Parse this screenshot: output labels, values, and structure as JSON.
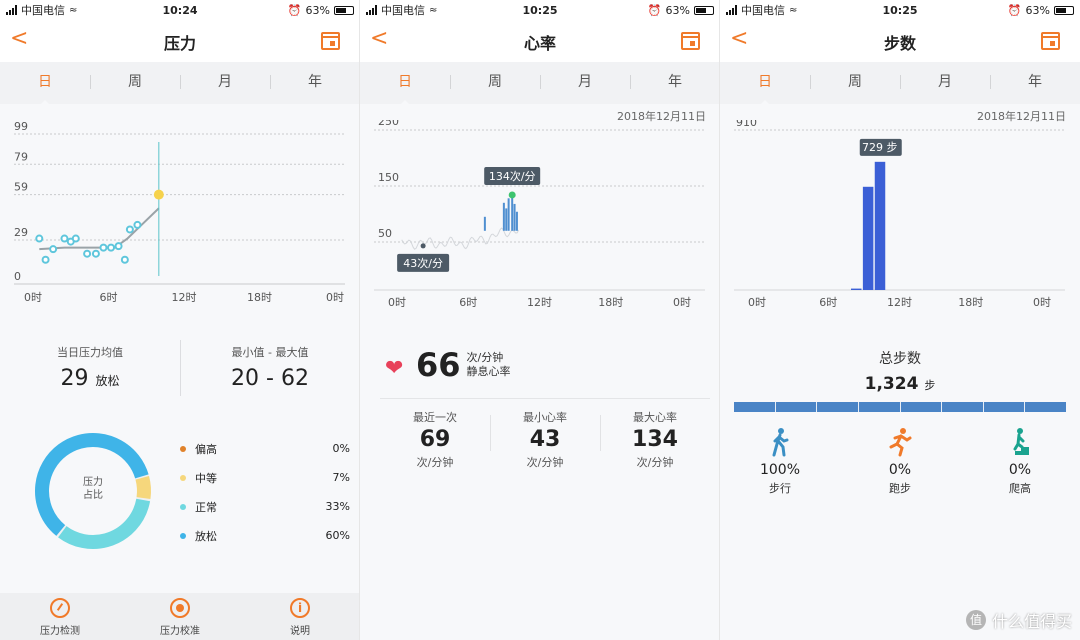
{
  "status_bars": [
    {
      "carrier": "中国电信",
      "time": "10:24",
      "battery": "63%",
      "battery_level": 0.63
    },
    {
      "carrier": "中国电信",
      "time": "10:25",
      "battery": "63%",
      "battery_level": 0.63
    },
    {
      "carrier": "中国电信",
      "time": "10:25",
      "battery": "63%",
      "battery_level": 0.63
    }
  ],
  "tabs": [
    "日",
    "周",
    "月",
    "年"
  ],
  "stress": {
    "title": "压力",
    "chart_data": {
      "type": "line",
      "title": "",
      "y_ticks": [
        "99",
        "79",
        "59",
        "29",
        "0"
      ],
      "x_ticks": [
        "0时",
        "6时",
        "12时",
        "18时",
        "0时"
      ],
      "ylim": [
        0,
        99
      ],
      "xlim_hours": [
        0,
        24
      ],
      "points": [
        {
          "hour": 0.5,
          "value": 30
        },
        {
          "hour": 1.0,
          "value": 16
        },
        {
          "hour": 1.6,
          "value": 23
        },
        {
          "hour": 2.5,
          "value": 30
        },
        {
          "hour": 3.0,
          "value": 28
        },
        {
          "hour": 3.4,
          "value": 30
        },
        {
          "hour": 4.3,
          "value": 20
        },
        {
          "hour": 5.0,
          "value": 20
        },
        {
          "hour": 5.6,
          "value": 24
        },
        {
          "hour": 6.2,
          "value": 24
        },
        {
          "hour": 6.8,
          "value": 25
        },
        {
          "hour": 7.3,
          "value": 16
        },
        {
          "hour": 7.7,
          "value": 36
        },
        {
          "hour": 8.3,
          "value": 39
        }
      ],
      "trend": [
        {
          "hour": 0.5,
          "value": 23
        },
        {
          "hour": 2.5,
          "value": 24
        },
        {
          "hour": 4.5,
          "value": 24
        },
        {
          "hour": 6.5,
          "value": 24
        },
        {
          "hour": 7.5,
          "value": 30
        },
        {
          "hour": 8.5,
          "value": 38
        },
        {
          "hour": 10.0,
          "value": 50
        }
      ],
      "current": {
        "hour": 10.0,
        "value": 59
      }
    },
    "avg_label": "当日压力均值",
    "avg_value": "29",
    "avg_unit": "放松",
    "range_label": "最小值 - 最大值",
    "range_value": "20 - 62",
    "donut_label_1": "压力",
    "donut_label_2": "占比",
    "breakdown": [
      {
        "name": "偏高",
        "pct": "0%",
        "value": 0,
        "color": "#e0822a"
      },
      {
        "name": "中等",
        "pct": "7%",
        "value": 7,
        "color": "#f6d77c"
      },
      {
        "name": "正常",
        "pct": "33%",
        "value": 33,
        "color": "#6fd8e0"
      },
      {
        "name": "放松",
        "pct": "60%",
        "value": 60,
        "color": "#3fb4e8"
      }
    ],
    "bottom": [
      {
        "label": "压力检测",
        "icon": "gauge-icon"
      },
      {
        "label": "压力校准",
        "icon": "target-icon"
      },
      {
        "label": "说明",
        "icon": "info-icon"
      }
    ]
  },
  "heart": {
    "title": "心率",
    "date": "2018年12月11日",
    "chart_data": {
      "type": "line",
      "title": "",
      "y_ticks": [
        "250",
        "150",
        "50"
      ],
      "x_ticks": [
        "0时",
        "6时",
        "12时",
        "18时",
        "0时"
      ],
      "ylim": [
        0,
        250
      ],
      "xlim_hours": [
        0,
        24
      ],
      "max_tooltip": "134次/分",
      "min_tooltip": "43次/分",
      "max_point": {
        "hour": 9.7,
        "value": 134
      },
      "min_point": {
        "hour": 2.2,
        "value": 43
      },
      "spikes": [
        {
          "hour": 7.4,
          "value": 95
        },
        {
          "hour": 9.0,
          "value": 120
        },
        {
          "hour": 9.2,
          "value": 110
        },
        {
          "hour": 9.4,
          "value": 128
        },
        {
          "hour": 9.7,
          "value": 134
        },
        {
          "hour": 9.9,
          "value": 118
        },
        {
          "hour": 10.1,
          "value": 104
        }
      ]
    },
    "resting_value": "66",
    "resting_unit": "次/分钟",
    "resting_label": "静息心率",
    "stats": [
      {
        "label": "最近一次",
        "value": "69",
        "unit": "次/分钟"
      },
      {
        "label": "最小心率",
        "value": "43",
        "unit": "次/分钟"
      },
      {
        "label": "最大心率",
        "value": "134",
        "unit": "次/分钟"
      }
    ]
  },
  "steps": {
    "title": "步数",
    "date": "2018年12月11日",
    "chart_data": {
      "type": "bar",
      "title": "",
      "y_ticks": [
        "910"
      ],
      "x_ticks": [
        "0时",
        "6时",
        "12时",
        "18时",
        "0时"
      ],
      "ylim": [
        0,
        910
      ],
      "tooltip": "729 步",
      "bars": [
        {
          "hour": 8.0,
          "value": 8
        },
        {
          "hour": 9.0,
          "value": 587
        },
        {
          "hour": 10.0,
          "value": 729
        }
      ]
    },
    "total_label": "总步数",
    "total_value": "1,324",
    "total_unit": "步",
    "modes": [
      {
        "name": "步行",
        "pct": "100%",
        "icon": "walking-icon",
        "color": "#3b8fc4"
      },
      {
        "name": "跑步",
        "pct": "0%",
        "icon": "running-icon",
        "color": "#f07a2a"
      },
      {
        "name": "爬高",
        "pct": "0%",
        "icon": "climbing-icon",
        "color": "#1aa38f"
      }
    ]
  },
  "watermark": "什么值得买",
  "colors": {
    "accent": "#f07a2a",
    "heart": "#e8415a",
    "steps_bar": "#3b5fd6"
  }
}
